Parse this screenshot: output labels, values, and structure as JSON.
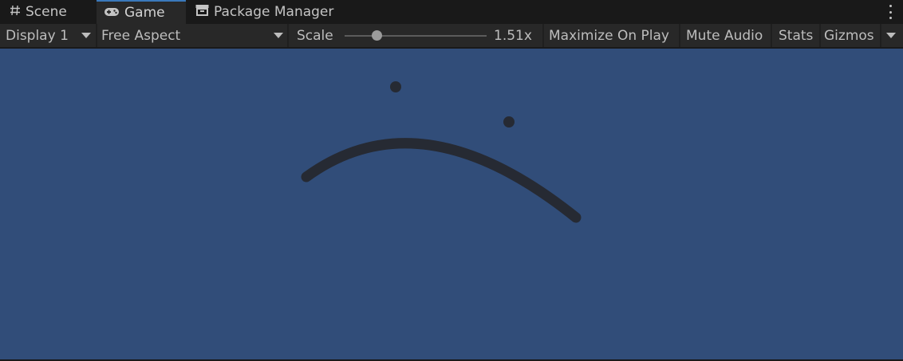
{
  "tabs": {
    "scene": {
      "label": "Scene",
      "icon": "hash-icon"
    },
    "game": {
      "label": "Game",
      "icon": "gamepad-icon",
      "active": true
    },
    "package_manager": {
      "label": "Package Manager",
      "icon": "package-icon"
    }
  },
  "toolbar": {
    "display": "Display 1",
    "aspect": "Free Aspect",
    "scale_label": "Scale",
    "scale_value": "1.51x",
    "scale_fraction": 0.23,
    "maximize": "Maximize On Play",
    "mute": "Mute Audio",
    "stats": "Stats",
    "gizmos": "Gizmos"
  },
  "colors": {
    "accent": "#3a79bb",
    "game_background": "#314d79",
    "sprite": "#262a33",
    "toolbar": "#282828",
    "chrome": "#191919"
  }
}
